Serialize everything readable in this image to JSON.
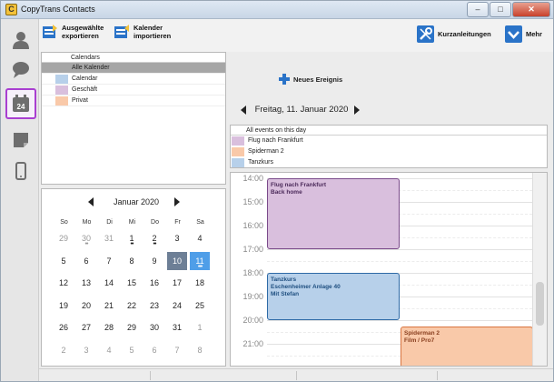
{
  "window": {
    "title": "CopyTrans Contacts",
    "icon_letter": "C",
    "controls": {
      "minimize": "–",
      "maximize": "□",
      "close": "✕"
    }
  },
  "nav": [
    {
      "name": "contacts-nav",
      "icon": "person-icon"
    },
    {
      "name": "messages-nav",
      "icon": "chat-bubble-icon"
    },
    {
      "name": "calendar-nav",
      "icon": "calendar-icon",
      "icon_text": "24",
      "active": true
    },
    {
      "name": "notes-nav",
      "icon": "note-icon"
    },
    {
      "name": "device-nav",
      "icon": "phone-icon"
    }
  ],
  "toolbar": {
    "export_label_1": "Ausgewählte",
    "export_label_2": "exportieren",
    "import_label_1": "Kalender",
    "import_label_2": "importieren",
    "guides_label": "Kurzanleitungen",
    "more_label": "Mehr"
  },
  "calendars": {
    "header": "Calendars",
    "items": [
      {
        "label": "Alle Kalender",
        "color": "",
        "selected": true
      },
      {
        "label": "Calendar",
        "color": "#b7d0ea"
      },
      {
        "label": "Geschäft",
        "color": "#d9bfdd"
      },
      {
        "label": "Privat",
        "color": "#f9c9a9"
      }
    ]
  },
  "month": {
    "title": "Januar 2020",
    "weekdays": [
      "So",
      "Mo",
      "Di",
      "Mi",
      "Do",
      "Fr",
      "Sa"
    ],
    "weeks": [
      [
        {
          "d": "29",
          "o": true
        },
        {
          "d": "30",
          "o": true,
          "dots": "••"
        },
        {
          "d": "31",
          "o": true
        },
        {
          "d": "1",
          "dots": "••"
        },
        {
          "d": "2",
          "dots": "••"
        },
        {
          "d": "3"
        },
        {
          "d": "4"
        }
      ],
      [
        {
          "d": "5"
        },
        {
          "d": "6"
        },
        {
          "d": "7"
        },
        {
          "d": "8"
        },
        {
          "d": "9"
        },
        {
          "d": "10",
          "s": "sel10"
        },
        {
          "d": "11",
          "s": "sel11",
          "dots": "•••"
        }
      ],
      [
        {
          "d": "12"
        },
        {
          "d": "13"
        },
        {
          "d": "14"
        },
        {
          "d": "15"
        },
        {
          "d": "16"
        },
        {
          "d": "17"
        },
        {
          "d": "18"
        }
      ],
      [
        {
          "d": "19"
        },
        {
          "d": "20"
        },
        {
          "d": "21"
        },
        {
          "d": "22"
        },
        {
          "d": "23"
        },
        {
          "d": "24"
        },
        {
          "d": "25"
        }
      ],
      [
        {
          "d": "26"
        },
        {
          "d": "27"
        },
        {
          "d": "28"
        },
        {
          "d": "29"
        },
        {
          "d": "30"
        },
        {
          "d": "31"
        },
        {
          "d": "1",
          "o": true
        }
      ],
      [
        {
          "d": "2",
          "o": true
        },
        {
          "d": "3",
          "o": true
        },
        {
          "d": "4",
          "o": true
        },
        {
          "d": "5",
          "o": true
        },
        {
          "d": "6",
          "o": true
        },
        {
          "d": "7",
          "o": true
        },
        {
          "d": "8",
          "o": true
        }
      ]
    ]
  },
  "day": {
    "new_event_label": "Neues Ereignis",
    "title": "Freitag, 11. Januar 2020",
    "events_header": "All events on this day",
    "events": [
      {
        "label": "Flug nach Frankfurt",
        "color": "#d9bfdd"
      },
      {
        "label": "Spiderman 2",
        "color": "#f9c9a9"
      },
      {
        "label": "Tanzkurs",
        "color": "#b7d0ea"
      }
    ]
  },
  "timeline": {
    "hours": [
      "14:00",
      "15:00",
      "16:00",
      "17:00",
      "18:00",
      "19:00",
      "20:00",
      "21:00"
    ],
    "events": [
      {
        "lines": [
          "Flug nach Frankfurt",
          "Back home"
        ],
        "start": "14:00",
        "end": "17:00",
        "column": "left",
        "bg": "#d9bfdd",
        "border": "#7a4a8a",
        "text_color": "#4b2a5a"
      },
      {
        "lines": [
          "Tanzkurs",
          "Eschenheimer Anlage 40",
          "Mit Stefan"
        ],
        "start": "18:00",
        "end": "20:00",
        "column": "left",
        "bg": "#b7d0ea",
        "border": "#2e6aa6",
        "text_color": "#1f4f80"
      },
      {
        "lines": [
          "Spiderman 2",
          "Film / Pro7"
        ],
        "start": "20:15",
        "end": "22:00",
        "column": "right",
        "bg": "#f9c9a9",
        "border": "#d8743f",
        "text_color": "#8a4020"
      }
    ]
  }
}
